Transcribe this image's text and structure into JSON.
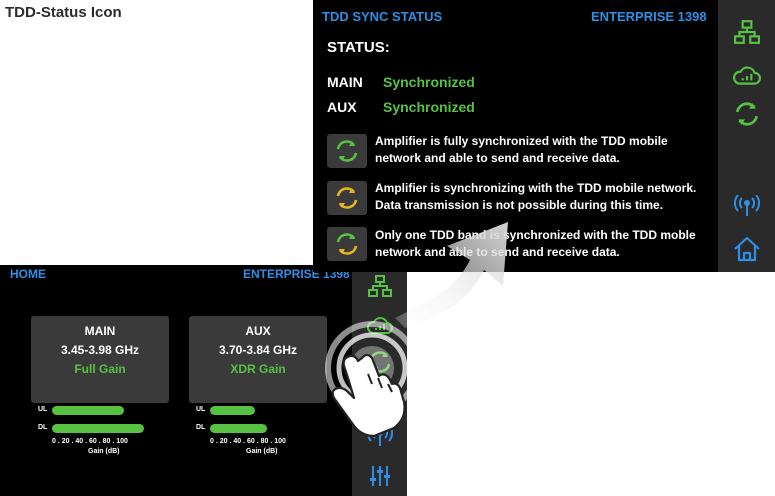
{
  "page": {
    "title": "TDD-Status Icon"
  },
  "home": {
    "title": "HOME",
    "device": "ENTERPRISE 1398",
    "cards": [
      {
        "name": "MAIN",
        "freq": "3.45-3.98 GHz",
        "gain": "Full Gain"
      },
      {
        "name": "AUX",
        "freq": "3.70-3.84 GHz",
        "gain": "XDR Gain"
      }
    ],
    "bars": {
      "ul_label": "UL",
      "dl_label": "DL",
      "scale": "0 . 20 . 40 . 60 . 80 . 100",
      "unit": "Gain (dB)"
    },
    "sidebar_icons": [
      "network-icon",
      "cloud-signal-icon",
      "sync-icon",
      "antenna-icon",
      "sliders-icon"
    ]
  },
  "tdd": {
    "title": "TDD SYNC STATUS",
    "device": "ENTERPRISE 1398",
    "status_heading": "STATUS:",
    "rows": [
      {
        "key": "MAIN",
        "value": "Synchronized"
      },
      {
        "key": "AUX",
        "value": "Synchronized"
      }
    ],
    "legend": [
      {
        "line1": "Amplifier is fully synchronized with the TDD mobile",
        "line2": "network and able to send and receive data."
      },
      {
        "line1": "Amplifier is synchronizing with the TDD mobile network.",
        "line2": "Data transmission is not possible during this time."
      },
      {
        "line1": "Only one TDD band is synchronized with the TDD moble",
        "line2": "network and able to send and receive data."
      }
    ],
    "sidebar_icons": [
      "network-icon",
      "cloud-signal-icon",
      "sync-icon",
      "antenna-icon",
      "home-icon"
    ]
  },
  "colors": {
    "accent_blue": "#2e8fe6",
    "status_green": "#57c242",
    "sync_yellow": "#e6b820",
    "panel": "#3a3a3a",
    "sidebar": "#2a2a2a"
  }
}
